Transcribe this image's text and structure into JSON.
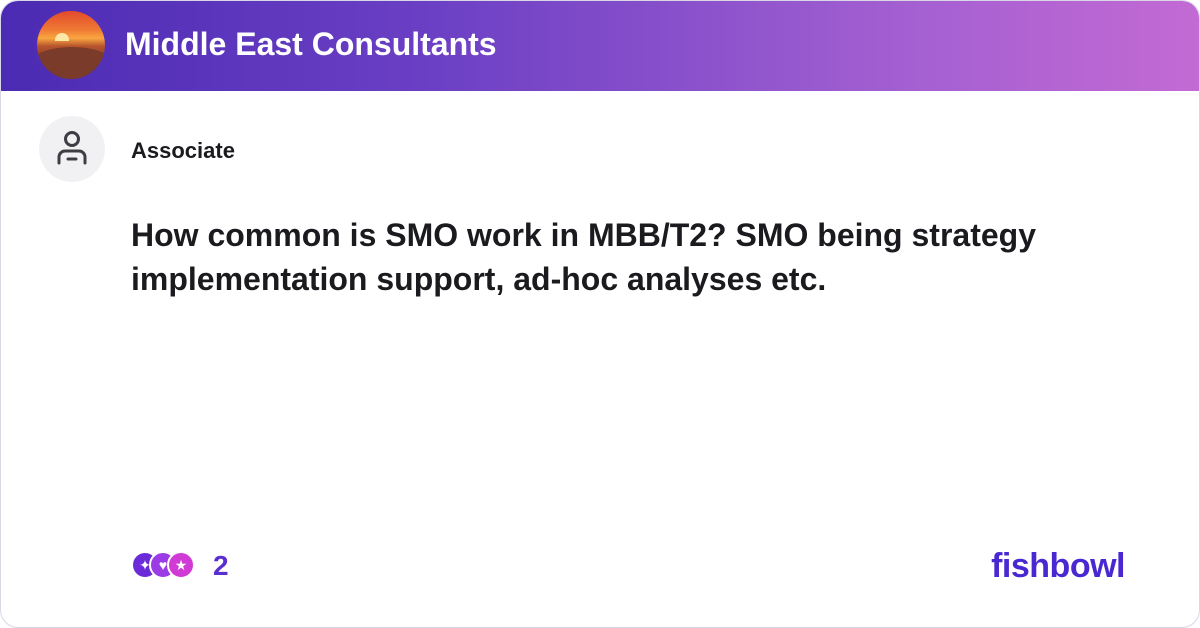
{
  "header": {
    "group_title": "Middle East Consultants",
    "gradient_colors": [
      "#4b2bb3",
      "#a35fd1",
      "#c36ad4"
    ]
  },
  "post": {
    "author_role": "Associate",
    "question": "How common is SMO work in MBB/T2? SMO being strategy implementation support, ad-hoc analyses etc."
  },
  "reactions": {
    "icons": [
      "like-icon",
      "heart-icon",
      "star-icon"
    ],
    "count": "2"
  },
  "brand": {
    "logo_text": "fishbowl",
    "color": "#4a28d1"
  }
}
